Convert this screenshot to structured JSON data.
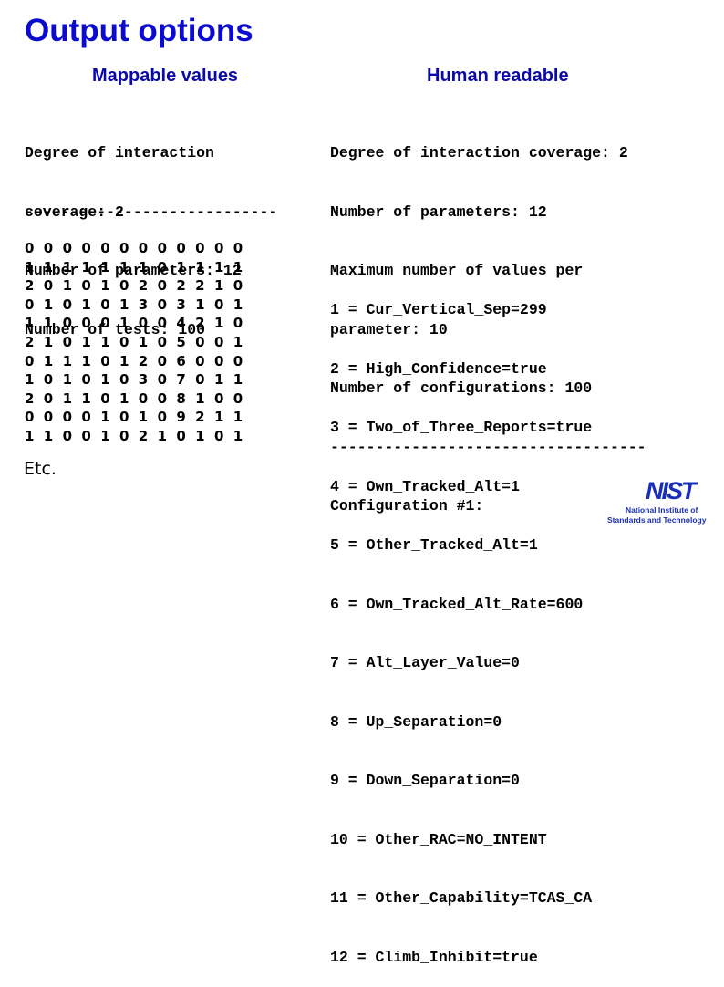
{
  "slide": {
    "title": "Output options"
  },
  "left": {
    "heading": "Mappable values",
    "info_lines": [
      "Degree of interaction",
      "coverage: 2",
      "Number of parameters: 12",
      "Number of tests: 100"
    ],
    "separator": "----------------------------",
    "matrix": [
      [
        "0",
        "0",
        "0",
        "0",
        "0",
        "0",
        "0",
        "0",
        "0",
        "0",
        "0",
        "0"
      ],
      [
        "1",
        "1",
        "1",
        "1",
        "1",
        "1",
        "1",
        "0",
        "1",
        "1",
        "1",
        "1"
      ],
      [
        "2",
        "0",
        "1",
        "0",
        "1",
        "0",
        "2",
        "0",
        "2",
        "2",
        "1",
        "0"
      ],
      [
        "0",
        "1",
        "0",
        "1",
        "0",
        "1",
        "3",
        "0",
        "3",
        "1",
        "0",
        "1"
      ],
      [
        "1",
        "1",
        "0",
        "0",
        "0",
        "1",
        "0",
        "0",
        "4",
        "2",
        "1",
        "0"
      ],
      [
        "2",
        "1",
        "0",
        "1",
        "1",
        "0",
        "1",
        "0",
        "5",
        "0",
        "0",
        "1"
      ],
      [
        "0",
        "1",
        "1",
        "1",
        "0",
        "1",
        "2",
        "0",
        "6",
        "0",
        "0",
        "0"
      ],
      [
        "1",
        "0",
        "1",
        "0",
        "1",
        "0",
        "3",
        "0",
        "7",
        "0",
        "1",
        "1"
      ],
      [
        "2",
        "0",
        "1",
        "1",
        "0",
        "1",
        "0",
        "0",
        "8",
        "1",
        "0",
        "0"
      ],
      [
        "0",
        "0",
        "0",
        "0",
        "1",
        "0",
        "1",
        "0",
        "9",
        "2",
        "1",
        "1"
      ],
      [
        "1",
        "1",
        "0",
        "0",
        "1",
        "0",
        "2",
        "1",
        "0",
        "1",
        "0",
        "1"
      ]
    ],
    "etc": "Etc."
  },
  "right": {
    "heading": "Human readable",
    "info_lines": [
      "Degree of interaction coverage: 2",
      "Number of parameters: 12",
      "Maximum number of values per",
      "parameter: 10",
      "Number of configurations: 100",
      "-----------------------------------",
      "Configuration #1:"
    ],
    "config_lines": [
      "1 = Cur_Vertical_Sep=299",
      "2 = High_Confidence=true",
      "3 = Two_of_Three_Reports=true",
      "4 = Own_Tracked_Alt=1",
      "5 = Other_Tracked_Alt=1",
      "6 = Own_Tracked_Alt_Rate=600",
      "7 = Alt_Layer_Value=0",
      "8 = Up_Separation=0",
      "9 = Down_Separation=0",
      "10 = Other_RAC=NO_INTENT",
      "11 = Other_Capability=TCAS_CA",
      "12 = Climb_Inhibit=true"
    ]
  },
  "logo": {
    "wordmark": "NIST",
    "line1": "National Institute of",
    "line2": "Standards and Technology"
  },
  "colors": {
    "title": "#0a0ad0",
    "heading": "#0a0aa8",
    "logo": "#1a2fb8"
  }
}
